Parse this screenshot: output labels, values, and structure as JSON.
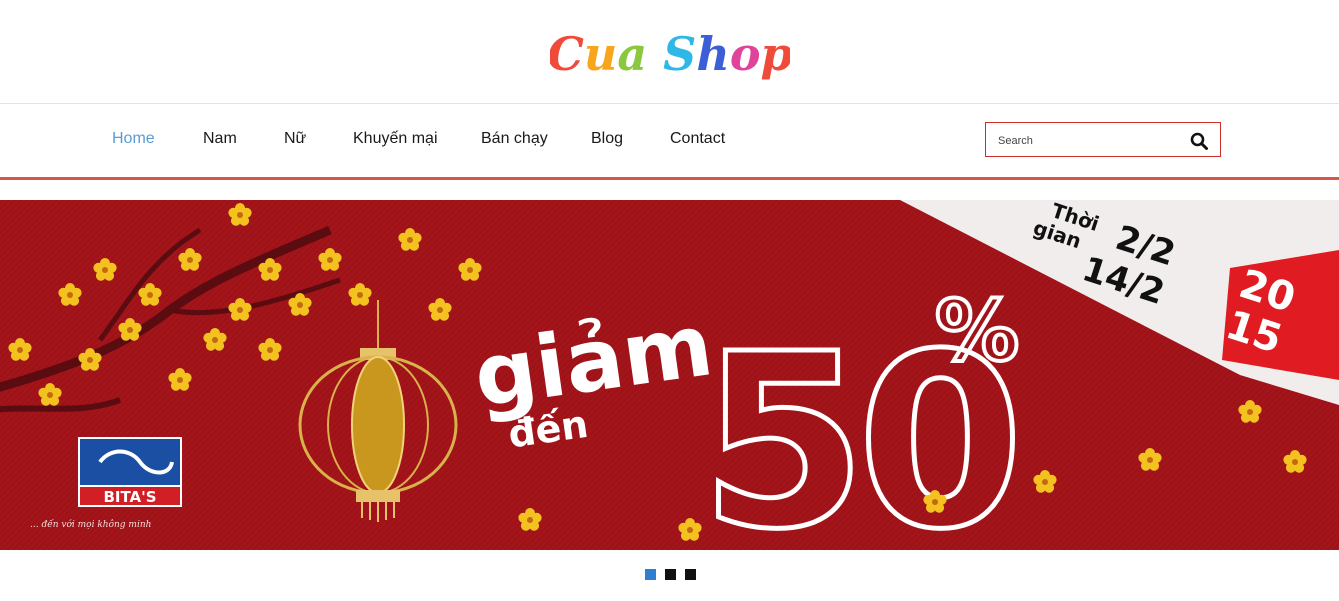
{
  "brand": {
    "logo_text": "Cua Shop",
    "logo_colors": [
      "#f04a3a",
      "#f7a51c",
      "#8bc83f",
      "#2fb7e6",
      "#3c5fd8",
      "#e0449a"
    ]
  },
  "nav": {
    "items": [
      {
        "label": "Home",
        "active": true
      },
      {
        "label": "Nam",
        "active": false
      },
      {
        "label": "Nữ",
        "active": false
      },
      {
        "label": "Khuyến mại",
        "active": false
      },
      {
        "label": "Bán chạy",
        "active": false
      },
      {
        "label": "Blog",
        "active": false
      },
      {
        "label": "Contact",
        "active": false
      }
    ]
  },
  "search": {
    "placeholder": "Search",
    "value": "",
    "icon": "search-icon"
  },
  "banner": {
    "headline_1": "giảm",
    "headline_2": "đến",
    "discount_number": "50",
    "percent_sign": "%",
    "ribbon_label_1": "Thời",
    "ribbon_label_2": "gian",
    "date_from": "2/2",
    "date_to": "14/2",
    "year_top": "20",
    "year_bottom": "15",
    "brand_name": "BITA'S",
    "brand_tagline": "... đến với mọi không minh"
  },
  "slider": {
    "slide_count": 3,
    "active_index": 0
  },
  "colors": {
    "accent_red": "#d9534f",
    "active_nav": "#5a9bd5",
    "banner_bg": "#9e1218",
    "active_dot": "#2f7fd0"
  }
}
